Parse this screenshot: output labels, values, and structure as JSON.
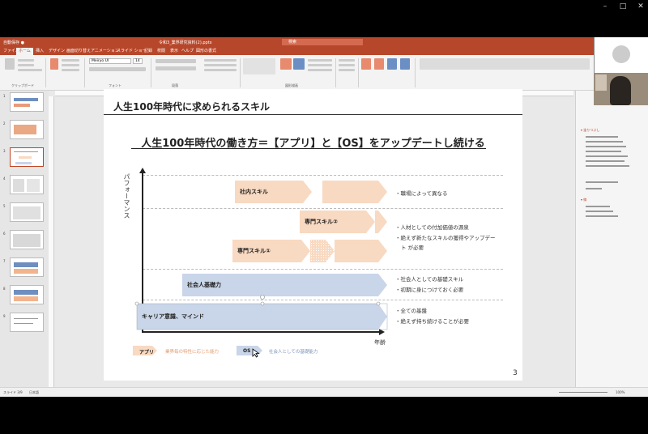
{
  "slide": {
    "title": "人生100年時代に求められるスキル",
    "heading": "人生100年時代の働き方＝【アプリ】と【OS】をアップデートし続ける",
    "y_axis_label": "パフォーマンス",
    "x_axis_label": "年齢",
    "page_number": "3",
    "bars": {
      "shanai": "社内スキル",
      "senmon2": "専門スキル②",
      "senmon1": "専門スキル①",
      "shakaijin": "社会人基礎力",
      "career": "キャリア意識、マインド"
    },
    "bullets": {
      "b1": "職場によって異なる",
      "b2": "人材としての付加価値の源泉",
      "b3": "絶えず新たなスキルの獲得やアップデー",
      "b3b": "ト が必要",
      "b4": "社会人としての基礎スキル",
      "b5": "初期に身につけておく必要",
      "b6": "全ての基盤",
      "b7": "絶えず持ち続けることが必要"
    },
    "legend": {
      "app_label": "アプリ",
      "app_text": "業界毎の特性に応じた能力",
      "os_label": "OS",
      "os_text": "社会人としての基礎能力"
    },
    "colors": {
      "app": "#f8d9c1",
      "os": "#c9d5e8"
    }
  },
  "window": {
    "ppt_title": "令和3_業界研究資料(2).pptx",
    "search": "検索"
  },
  "ribbon_tabs": [
    "ファイル",
    "ホーム",
    "挿入",
    "デザイン",
    "画面切り替え",
    "アニメーション",
    "スライド ショー",
    "記録",
    "校閲",
    "表示",
    "ヘルプ",
    "図形の書式"
  ],
  "font_box": "Meiryo UI",
  "font_size": "14",
  "status": {
    "slide": "スライド 3/9",
    "lang": "日本語",
    "zoom": "100%"
  }
}
